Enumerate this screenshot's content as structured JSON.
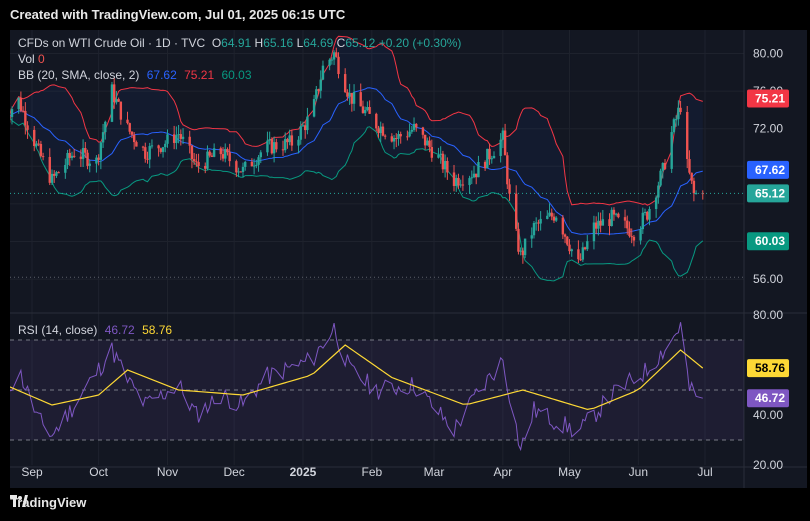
{
  "header": {
    "title": "Created with TradingView.com, Jul 01, 2025 06:15 UTC"
  },
  "footer": {
    "brand": "TradingView"
  },
  "legend": {
    "symbol": "CFDs on WTI Crude Oil · 1D · TVC",
    "o_label": "O",
    "o_value": "64.91",
    "h_label": "H",
    "h_value": "65.16",
    "l_label": "L",
    "l_value": "64.69",
    "c_label": "C",
    "c_value": "65.12",
    "change": "+0.20 (+0.30%)",
    "vol_label": "Vol",
    "vol_value": "0",
    "bb_label": "BB (20, SMA, close, 2)",
    "bb_basis": "67.62",
    "bb_upper": "75.21",
    "bb_lower": "60.03",
    "rsi_label": "RSI (14, close)",
    "rsi_value": "46.72",
    "rsi_ma": "58.76"
  },
  "colors": {
    "background": "#131722",
    "up": "#26a69a",
    "down": "#ef5350",
    "bb_upper": "#f23645",
    "bb_basis": "#2962ff",
    "bb_lower": "#089981",
    "rsi": "#7e57c2",
    "rsi_ma": "#fdd835",
    "axis_text": "#d1d4dc"
  },
  "chart_data": [
    {
      "type": "candlestick",
      "title": "CFDs on WTI Crude Oil · 1D · TVC",
      "x_ticks": [
        "Sep",
        "Oct",
        "Nov",
        "Dec",
        "2025",
        "Feb",
        "Mar",
        "Apr",
        "May",
        "Jun",
        "Jul"
      ],
      "y_ticks": [
        "80.00",
        "76.00",
        "72.00",
        "56.00"
      ],
      "ylim": [
        52.5,
        82.5
      ],
      "current_price": "65.12",
      "price_tags": [
        {
          "name": "BB upper",
          "value": "75.21"
        },
        {
          "name": "BB basis",
          "value": "67.62"
        },
        {
          "name": "close",
          "value": "65.12"
        },
        {
          "name": "BB lower",
          "value": "60.03"
        }
      ],
      "approx_close_path": [
        {
          "x": "Aug 20",
          "y": 73.5
        },
        {
          "x": "Aug 26",
          "y": 75.0
        },
        {
          "x": "Sep 04",
          "y": 69.5
        },
        {
          "x": "Sep 10",
          "y": 66.5
        },
        {
          "x": "Sep 20",
          "y": 69.5
        },
        {
          "x": "Sep 30",
          "y": 68.5
        },
        {
          "x": "Oct 07",
          "y": 76.0
        },
        {
          "x": "Oct 14",
          "y": 72.0
        },
        {
          "x": "Oct 22",
          "y": 69.5
        },
        {
          "x": "Oct 31",
          "y": 70.5
        },
        {
          "x": "Nov 06",
          "y": 71.5
        },
        {
          "x": "Nov 14",
          "y": 68.0
        },
        {
          "x": "Nov 25",
          "y": 69.5
        },
        {
          "x": "Dec 05",
          "y": 67.5
        },
        {
          "x": "Dec 15",
          "y": 70.0
        },
        {
          "x": "Dec 27",
          "y": 70.5
        },
        {
          "x": "Jan 05",
          "y": 73.5
        },
        {
          "x": "Jan 10",
          "y": 78.5
        },
        {
          "x": "Jan 15",
          "y": 80.0
        },
        {
          "x": "Jan 22",
          "y": 75.5
        },
        {
          "x": "Feb 03",
          "y": 72.5
        },
        {
          "x": "Feb 12",
          "y": 71.0
        },
        {
          "x": "Feb 20",
          "y": 72.0
        },
        {
          "x": "Mar 01",
          "y": 69.5
        },
        {
          "x": "Mar 10",
          "y": 66.5
        },
        {
          "x": "Mar 20",
          "y": 67.5
        },
        {
          "x": "Apr 01",
          "y": 71.0
        },
        {
          "x": "Apr 05",
          "y": 62.5
        },
        {
          "x": "Apr 09",
          "y": 58.5
        },
        {
          "x": "Apr 15",
          "y": 61.5
        },
        {
          "x": "Apr 25",
          "y": 63.0
        },
        {
          "x": "May 05",
          "y": 57.5
        },
        {
          "x": "May 12",
          "y": 61.5
        },
        {
          "x": "May 20",
          "y": 62.5
        },
        {
          "x": "May 30",
          "y": 61.0
        },
        {
          "x": "Jun 05",
          "y": 63.0
        },
        {
          "x": "Jun 12",
          "y": 67.5
        },
        {
          "x": "Jun 16",
          "y": 71.5
        },
        {
          "x": "Jun 20",
          "y": 74.5
        },
        {
          "x": "Jun 23",
          "y": 68.0
        },
        {
          "x": "Jun 26",
          "y": 65.0
        },
        {
          "x": "Jun 30",
          "y": 65.1
        }
      ]
    },
    {
      "type": "line",
      "title": "RSI (14, close)",
      "y_ticks": [
        "80.00",
        "40.00",
        "20.00"
      ],
      "ylim": [
        20,
        80
      ],
      "levels": [
        70,
        50,
        30
      ],
      "series": [
        {
          "name": "RSI",
          "last": "46.72",
          "values": [
            {
              "x": "Aug 20",
              "y": 48
            },
            {
              "x": "Aug 26",
              "y": 58
            },
            {
              "x": "Sep 04",
              "y": 38
            },
            {
              "x": "Sep 10",
              "y": 32
            },
            {
              "x": "Sep 20",
              "y": 44
            },
            {
              "x": "Oct 07",
              "y": 66
            },
            {
              "x": "Oct 14",
              "y": 54
            },
            {
              "x": "Oct 22",
              "y": 44
            },
            {
              "x": "Nov 06",
              "y": 52
            },
            {
              "x": "Nov 14",
              "y": 40
            },
            {
              "x": "Nov 25",
              "y": 48
            },
            {
              "x": "Dec 05",
              "y": 44
            },
            {
              "x": "Dec 15",
              "y": 55
            },
            {
              "x": "Jan 05",
              "y": 62
            },
            {
              "x": "Jan 15",
              "y": 75
            },
            {
              "x": "Jan 22",
              "y": 58
            },
            {
              "x": "Feb 03",
              "y": 50
            },
            {
              "x": "Feb 20",
              "y": 52
            },
            {
              "x": "Mar 10",
              "y": 34
            },
            {
              "x": "Mar 20",
              "y": 48
            },
            {
              "x": "Apr 01",
              "y": 62
            },
            {
              "x": "Apr 09",
              "y": 26
            },
            {
              "x": "Apr 15",
              "y": 42
            },
            {
              "x": "May 05",
              "y": 33
            },
            {
              "x": "May 20",
              "y": 48
            },
            {
              "x": "Jun 05",
              "y": 58
            },
            {
              "x": "Jun 16",
              "y": 70
            },
            {
              "x": "Jun 20",
              "y": 76
            },
            {
              "x": "Jun 24",
              "y": 50
            },
            {
              "x": "Jun 30",
              "y": 46.72
            }
          ]
        },
        {
          "name": "RSI-based MA",
          "last": "58.76",
          "values": [
            {
              "x": "Aug 20",
              "y": 52
            },
            {
              "x": "Sep 10",
              "y": 44
            },
            {
              "x": "Oct 01",
              "y": 48
            },
            {
              "x": "Oct 14",
              "y": 58
            },
            {
              "x": "Nov 06",
              "y": 50
            },
            {
              "x": "Dec 05",
              "y": 48
            },
            {
              "x": "Jan 05",
              "y": 56
            },
            {
              "x": "Jan 20",
              "y": 68
            },
            {
              "x": "Feb 10",
              "y": 55
            },
            {
              "x": "Mar 15",
              "y": 44
            },
            {
              "x": "Apr 10",
              "y": 50
            },
            {
              "x": "May 10",
              "y": 42
            },
            {
              "x": "Jun 01",
              "y": 50
            },
            {
              "x": "Jun 20",
              "y": 66
            },
            {
              "x": "Jun 30",
              "y": 58.76
            }
          ]
        }
      ]
    }
  ]
}
